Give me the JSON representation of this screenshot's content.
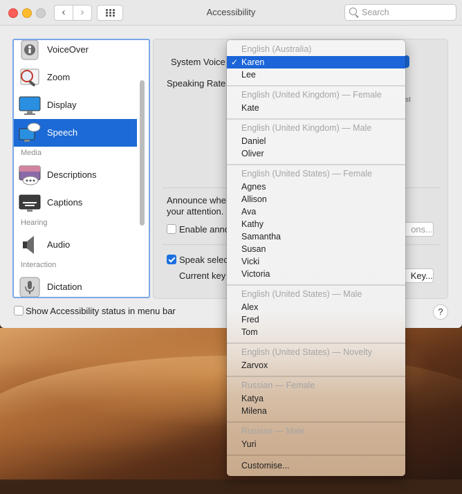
{
  "window": {
    "title": "Accessibility",
    "search_placeholder": "Search"
  },
  "sidebar": {
    "items": [
      {
        "label": "VoiceOver",
        "icon": "voiceover-icon"
      },
      {
        "label": "Zoom",
        "icon": "zoom-icon"
      },
      {
        "label": "Display",
        "icon": "display-icon"
      },
      {
        "label": "Speech",
        "icon": "speech-icon",
        "selected": true
      },
      {
        "label": "Descriptions",
        "icon": "descriptions-icon"
      },
      {
        "label": "Captions",
        "icon": "captions-icon"
      },
      {
        "label": "Audio",
        "icon": "audio-icon"
      },
      {
        "label": "Dictation",
        "icon": "dictation-icon"
      }
    ],
    "sections": [
      "Media",
      "Hearing",
      "Interaction"
    ]
  },
  "pane": {
    "system_voice_label": "System Voice",
    "speaking_rate_label": "Speaking Rate",
    "rate_edge_text": "st",
    "announce_line1": "Announce whe",
    "announce_line2": "your attention.",
    "enable_announce_label": "Enable anno",
    "options_button": "ons...",
    "speak_selected_label": "Speak selec",
    "current_key_label": "Current key",
    "change_key_button": "Key..."
  },
  "footer": {
    "show_status_label": "Show Accessibility status in menu bar",
    "help_label": "?"
  },
  "voice_menu": {
    "groups": [
      {
        "header": "English (Australia)",
        "items": [
          "Karen",
          "Lee"
        ]
      },
      {
        "header": "English (United Kingdom) — Female",
        "items": [
          "Kate"
        ]
      },
      {
        "header": "English (United Kingdom) — Male",
        "items": [
          "Daniel",
          "Oliver"
        ]
      },
      {
        "header": "English (United States) — Female",
        "items": [
          "Agnes",
          "Allison",
          "Ava",
          "Kathy",
          "Samantha",
          "Susan",
          "Vicki",
          "Victoria"
        ]
      },
      {
        "header": "English (United States) — Male",
        "items": [
          "Alex",
          "Fred",
          "Tom"
        ]
      },
      {
        "header": "English (United States) — Novelty",
        "items": [
          "Zarvox"
        ]
      },
      {
        "header": "Russian — Female",
        "items": [
          "Katya",
          "Milena"
        ]
      },
      {
        "header": "Russian — Male",
        "items": [
          "Yuri"
        ]
      }
    ],
    "selected": "Karen",
    "check_mark": "✓",
    "customise_label": "Customise..."
  }
}
